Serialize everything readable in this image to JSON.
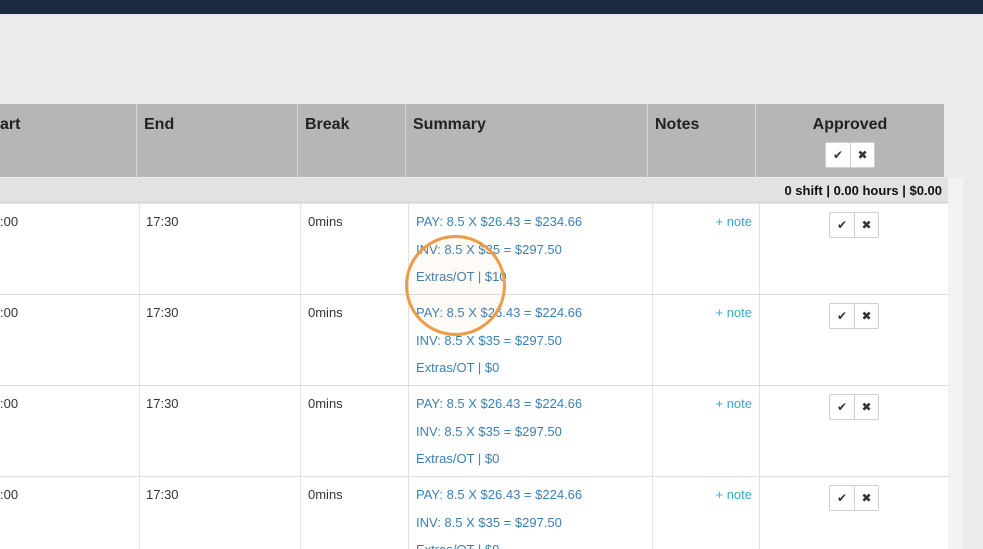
{
  "table": {
    "headers": {
      "start": "art",
      "end": "End",
      "break": "Break",
      "summary": "Summary",
      "notes": "Notes",
      "approved": "Approved"
    },
    "approve_icon": "check-icon",
    "reject_icon": "x-icon",
    "summary_totals": "0 shift | 0.00 hours | $0.00",
    "rows": [
      {
        "start": ":00",
        "end": "17:30",
        "break": "0mins",
        "pay": "PAY: 8.5 X $26.43 = $234.66",
        "inv": "INV: 8.5 X $35 = $297.50",
        "extras": "Extras/OT | $10",
        "note": "+ note"
      },
      {
        "start": ":00",
        "end": "17:30",
        "break": "0mins",
        "pay": "PAY: 8.5 X $26.43 = $224.66",
        "inv": "INV: 8.5 X $35 = $297.50",
        "extras": "Extras/OT | $0",
        "note": "+ note"
      },
      {
        "start": ":00",
        "end": "17:30",
        "break": "0mins",
        "pay": "PAY: 8.5 X $26.43 = $224.66",
        "inv": "INV: 8.5 X $35 = $297.50",
        "extras": "Extras/OT | $0",
        "note": "+ note"
      },
      {
        "start": ":00",
        "end": "17:30",
        "break": "0mins",
        "pay": "PAY: 8.5 X $26.43 = $224.66",
        "inv": "INV: 8.5 X $35 = $297.50",
        "extras": "Extras/OT | $0",
        "note": "+ note"
      }
    ]
  },
  "colors": {
    "topbar": "#1b2a41",
    "header_bg": "#b7b6b6",
    "link": "#3b80b5",
    "note_link": "#3aa7c6",
    "highlight_ring": "#ef9b43"
  }
}
